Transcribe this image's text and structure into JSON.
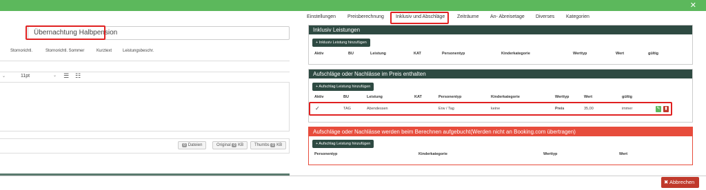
{
  "left": {
    "name_value": "Übernachtung Halbpension",
    "columns": [
      "Stornorichtl.",
      "Stornorichtl. Sommer",
      "Kurztext",
      "Leistungsbeschr."
    ],
    "editor": {
      "font_size": "11pt"
    },
    "files": {
      "dateien": "Dateien",
      "dateien_count": "0",
      "original": "Original",
      "original_size": "0",
      "original_unit": "KB",
      "thumbs": "Thumbs",
      "thumbs_size": "0",
      "thumbs_unit": "KB"
    }
  },
  "tabs": [
    "Einstellungen",
    "Preisberechnung",
    "Inklusiv und Abschläge",
    "Zeiträume",
    "An- Abreisetage",
    "Diverses",
    "Kategorien"
  ],
  "active_tab": "Inklusiv und Abschläge",
  "inklusiv": {
    "title": "Inklusiv Leistungen",
    "add": "+ Inklusiv Leistung hinzufügen",
    "headers": [
      "Aktiv",
      "BU",
      "Leistung",
      "KAT",
      "Personentyp",
      "Kinderkategorie",
      "Werttyp",
      "Wert",
      "gültig"
    ]
  },
  "aufschlaege": {
    "title": "Aufschläge oder Nachlässe im Preis enthalten",
    "add": "+ Aufschlag Leistung hinzufügen",
    "headers": [
      "Aktiv",
      "BU",
      "Leistung",
      "KAT",
      "Personentyp",
      "Kinderkategorie",
      "Werttyp",
      "Wert",
      "gültig"
    ],
    "row": {
      "aktiv": "✓",
      "bu": "TAG",
      "leistung": "Abendessen",
      "kat": "",
      "personentyp": "Erw / Tag",
      "kinderkategorie": "keine",
      "werttyp": "Preis",
      "wert": "35,00",
      "gueltig": "immer"
    }
  },
  "berechnen": {
    "title": "Aufschläge oder Nachlässe werden beim Berechnen aufgebucht(Werden nicht an Booking.com übertragen)",
    "add": "+ Aufschlag Leistung hinzufügen",
    "headers": [
      "Personentyp",
      "Kinderkategorie",
      "Werttyp",
      "Wert"
    ]
  },
  "footer": {
    "cancel": "✖ Abbrechen"
  },
  "colors": {
    "topbar": "#5cb85c",
    "header": "#2e4a42",
    "alert": "#e74c3c",
    "cancel": "#c0392b",
    "highlight": "#e02020"
  }
}
